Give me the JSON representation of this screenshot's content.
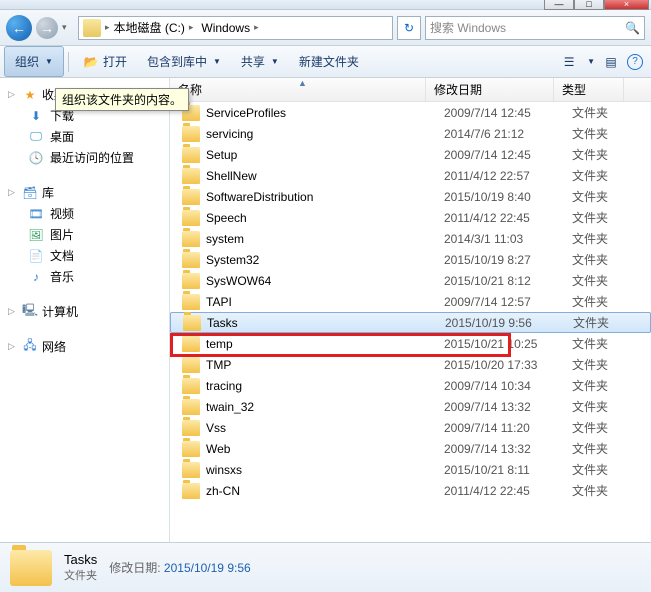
{
  "window": {
    "min": "—",
    "max": "□",
    "close": "×"
  },
  "nav": {
    "back": "←",
    "fwd": "→",
    "dd": "▾",
    "refresh": "↻"
  },
  "breadcrumb": {
    "seg1": "本地磁盘 (C:)",
    "seg2": "Windows",
    "arrow": "▸"
  },
  "search": {
    "placeholder": "搜索 Windows",
    "icon": "🔍"
  },
  "toolbar": {
    "organize": "组织",
    "open": "打开",
    "include": "包含到库中",
    "share": "共享",
    "newfolder": "新建文件夹",
    "dd": "▼",
    "view_icon": "☰",
    "preview_icon": "▤",
    "help_icon": "?"
  },
  "tooltip": "组织该文件夹的内容。",
  "sidebar": {
    "fav_tri": "▷",
    "favorites": "收藏夹",
    "downloads": "下载",
    "desktop": "桌面",
    "recent": "最近访问的位置",
    "lib_tri": "▷",
    "libraries": "库",
    "videos": "视频",
    "pictures": "图片",
    "documents": "文档",
    "music": "音乐",
    "comp_tri": "▷",
    "computer": "计算机",
    "net_tri": "▷",
    "network": "网络"
  },
  "columns": {
    "name": "名称",
    "date": "修改日期",
    "type": "类型",
    "sort": "▲"
  },
  "files": [
    {
      "name": "ServiceProfiles",
      "date": "2009/7/14 12:45",
      "type": "文件夹"
    },
    {
      "name": "servicing",
      "date": "2014/7/6 21:12",
      "type": "文件夹"
    },
    {
      "name": "Setup",
      "date": "2009/7/14 12:45",
      "type": "文件夹"
    },
    {
      "name": "ShellNew",
      "date": "2011/4/12 22:57",
      "type": "文件夹"
    },
    {
      "name": "SoftwareDistribution",
      "date": "2015/10/19 8:40",
      "type": "文件夹"
    },
    {
      "name": "Speech",
      "date": "2011/4/12 22:45",
      "type": "文件夹"
    },
    {
      "name": "system",
      "date": "2014/3/1 11:03",
      "type": "文件夹"
    },
    {
      "name": "System32",
      "date": "2015/10/19 8:27",
      "type": "文件夹"
    },
    {
      "name": "SysWOW64",
      "date": "2015/10/21 8:12",
      "type": "文件夹"
    },
    {
      "name": "TAPI",
      "date": "2009/7/14 12:57",
      "type": "文件夹"
    },
    {
      "name": "Tasks",
      "date": "2015/10/19 9:56",
      "type": "文件夹",
      "selected": true
    },
    {
      "name": "temp",
      "date": "2015/10/21 10:25",
      "type": "文件夹"
    },
    {
      "name": "TMP",
      "date": "2015/10/20 17:33",
      "type": "文件夹"
    },
    {
      "name": "tracing",
      "date": "2009/7/14 10:34",
      "type": "文件夹"
    },
    {
      "name": "twain_32",
      "date": "2009/7/14 13:32",
      "type": "文件夹"
    },
    {
      "name": "Vss",
      "date": "2009/7/14 11:20",
      "type": "文件夹"
    },
    {
      "name": "Web",
      "date": "2009/7/14 13:32",
      "type": "文件夹"
    },
    {
      "name": "winsxs",
      "date": "2015/10/21 8:11",
      "type": "文件夹"
    },
    {
      "name": "zh-CN",
      "date": "2011/4/12 22:45",
      "type": "文件夹"
    }
  ],
  "details": {
    "name": "Tasks",
    "type": "文件夹",
    "date_label": "修改日期:",
    "date_value": "2015/10/19 9:56"
  }
}
